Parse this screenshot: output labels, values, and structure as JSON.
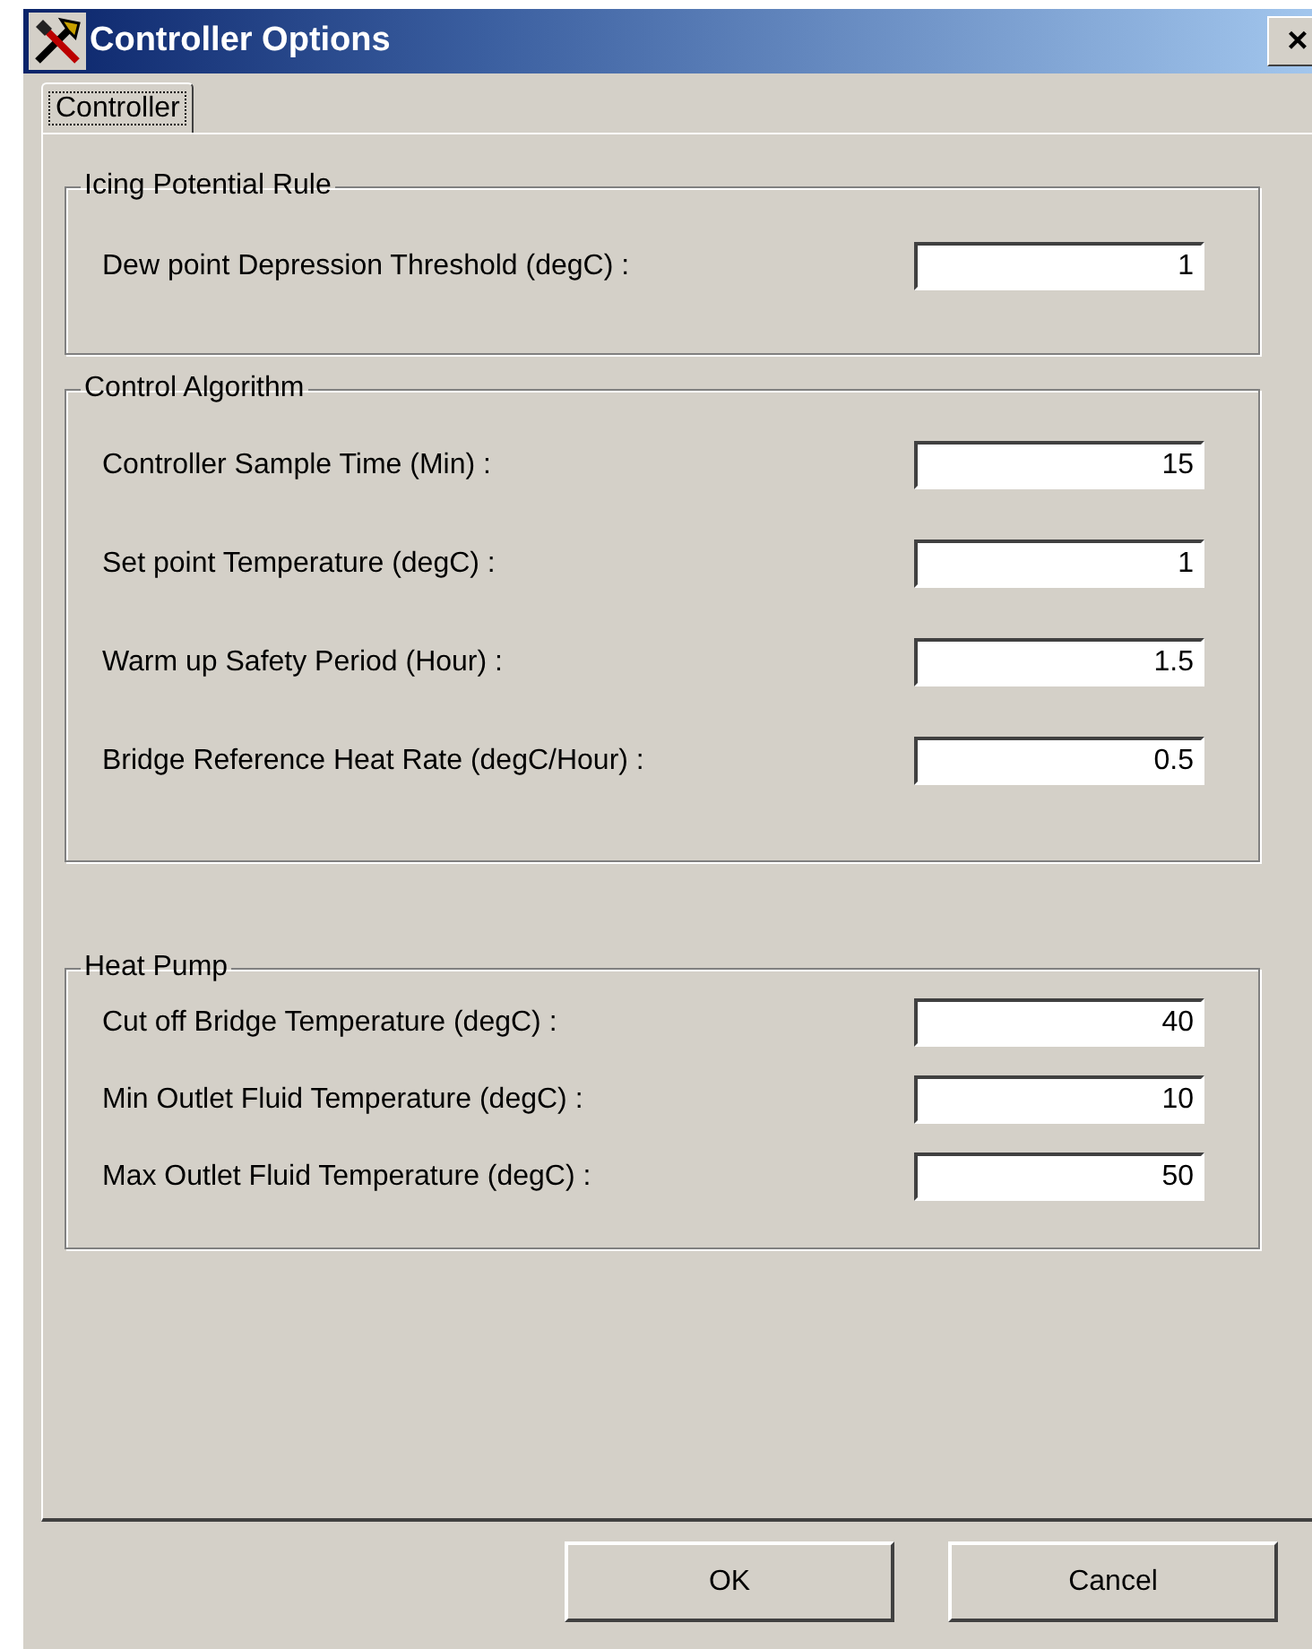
{
  "window": {
    "title": "Controller Options",
    "close": "×"
  },
  "tabs": [
    {
      "label": "Controller",
      "selected": true
    }
  ],
  "groups": [
    {
      "title": "Icing Potential Rule",
      "fields": [
        {
          "label": "Dew point Depression Threshold (degC) :",
          "value": "1"
        }
      ]
    },
    {
      "title": "Control Algorithm",
      "fields": [
        {
          "label": "Controller Sample Time (Min) :",
          "value": "15"
        },
        {
          "label": "Set point Temperature (degC) :",
          "value": "1"
        },
        {
          "label": "Warm up Safety Period (Hour) :",
          "value": "1.5"
        },
        {
          "label": "Bridge Reference Heat Rate (degC/Hour) :",
          "value": "0.5"
        }
      ]
    },
    {
      "title": "Heat Pump",
      "fields": [
        {
          "label": "Cut off Bridge Temperature (degC) :",
          "value": "40"
        },
        {
          "label": "Min Outlet Fluid Temperature (degC) :",
          "value": "10"
        },
        {
          "label": "Max Outlet Fluid Temperature (degC) :",
          "value": "50"
        }
      ]
    }
  ],
  "buttons": [
    "OK",
    "Cancel"
  ]
}
